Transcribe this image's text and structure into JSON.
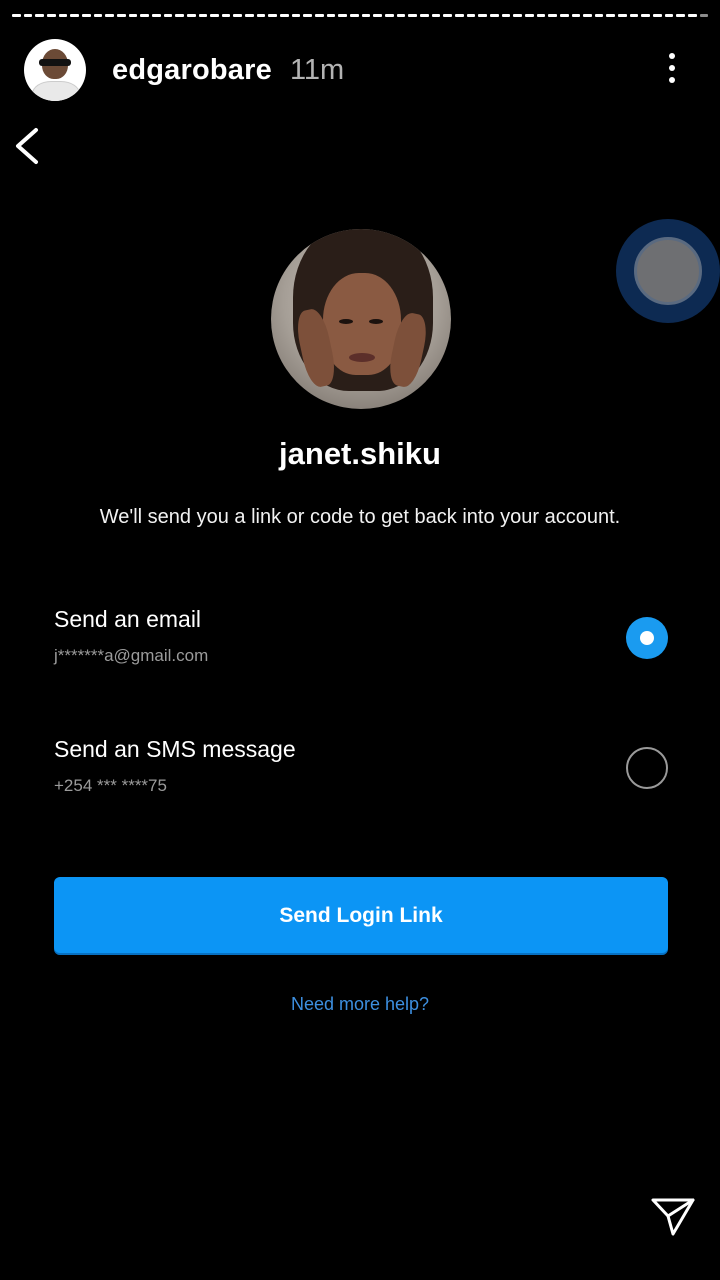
{
  "story": {
    "username": "edgarobare",
    "time_ago": "11m",
    "progress_segments": 60,
    "progress_completed": 59
  },
  "screen": {
    "profile_name": "janet.shiku",
    "subtitle": "We'll send you a link or code to get back into your account.",
    "options": [
      {
        "title": "Send an email",
        "detail": "j*******a@gmail.com",
        "selected": true
      },
      {
        "title": "Send an SMS message",
        "detail": "+254 *** ****75",
        "selected": false
      }
    ],
    "primary_button_label": "Send Login Link",
    "help_link": "Need more help?"
  },
  "icons": {
    "back": "chevron-left-icon",
    "more": "more-vertical-icon",
    "send": "paper-plane-icon"
  },
  "colors": {
    "accent": "#0c95f5",
    "link": "#3d8fe0",
    "background": "#000000"
  }
}
